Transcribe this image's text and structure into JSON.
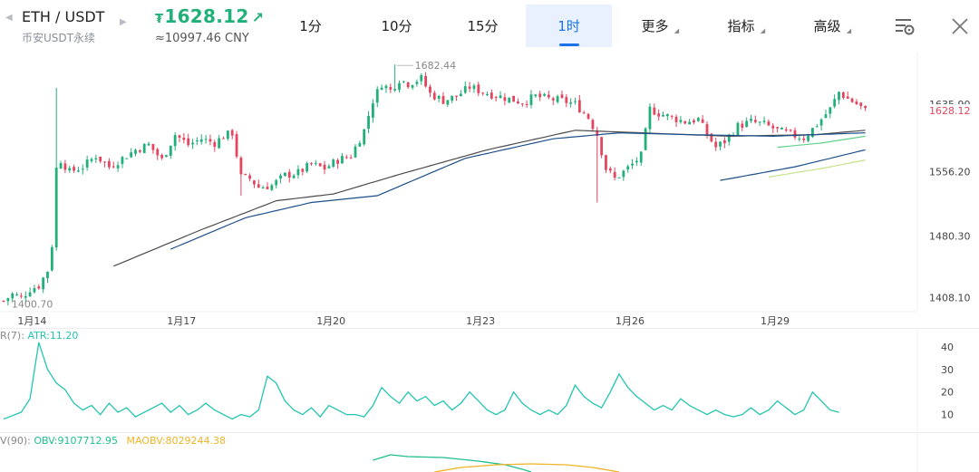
{
  "header": {
    "pair": "ETH / USDT",
    "subtitle": "币安USDT永续",
    "price": "1628.12",
    "currency_symbol": "₮",
    "price_cny": "≈10997.46 CNY",
    "tabs": [
      {
        "label": "1分"
      },
      {
        "label": "10分"
      },
      {
        "label": "15分"
      },
      {
        "label": "1时",
        "active": true
      },
      {
        "label": "更多",
        "dropdown": true
      },
      {
        "label": "指标",
        "dropdown": true
      },
      {
        "label": "高级",
        "dropdown": true
      }
    ],
    "icons": [
      "chart-settings-icon",
      "close-icon"
    ]
  },
  "colors": {
    "up": "#21b07a",
    "down": "#e5455f",
    "active_tab": "#1a73e8",
    "ma_dark": "#4b4b4b",
    "ma_blue": "#1c4f8a",
    "ma_green": "#5fd18d",
    "ma_lime": "#c8e38c",
    "atr": "#22c5b0",
    "obv": "#1fbf8f",
    "maobv": "#f0b429"
  },
  "chart_data": [
    {
      "type": "candlestick",
      "title": "",
      "x_tick_labels": [
        "1月14",
        "1月17",
        "1月20",
        "1月23",
        "1月26",
        "1月29"
      ],
      "y_tick_labels": [
        "1635.90",
        "1556.20",
        "1480.30",
        "1408.10"
      ],
      "y_ticks": [
        1635.9,
        1556.2,
        1480.3,
        1408.1
      ],
      "ylim": [
        1400,
        1688
      ],
      "last_price": 1628.12,
      "last_price_label": "1628.12",
      "high_marker": {
        "value": 1682.44,
        "label": "1682.44"
      },
      "low_marker": {
        "value": 1400.7,
        "label": "1400.70"
      },
      "close_path": [
        [
          0,
          1404
        ],
        [
          2,
          1412
        ],
        [
          4,
          1408
        ],
        [
          6,
          1418
        ],
        [
          8,
          1422
        ],
        [
          10,
          1440
        ],
        [
          11,
          1470
        ],
        [
          12,
          1560
        ],
        [
          13,
          1570
        ],
        [
          15,
          1556
        ],
        [
          18,
          1562
        ],
        [
          21,
          1575
        ],
        [
          24,
          1562
        ],
        [
          27,
          1572
        ],
        [
          30,
          1582
        ],
        [
          33,
          1588
        ],
        [
          36,
          1570
        ],
        [
          39,
          1600
        ],
        [
          42,
          1588
        ],
        [
          45,
          1595
        ],
        [
          48,
          1590
        ],
        [
          50,
          1598
        ],
        [
          52,
          1602
        ],
        [
          54,
          1550
        ],
        [
          56,
          1548
        ],
        [
          58,
          1538
        ],
        [
          61,
          1540
        ],
        [
          64,
          1552
        ],
        [
          67,
          1555
        ],
        [
          70,
          1565
        ],
        [
          73,
          1560
        ],
        [
          76,
          1570
        ],
        [
          79,
          1575
        ],
        [
          82,
          1605
        ],
        [
          84,
          1640
        ],
        [
          86,
          1660
        ],
        [
          88,
          1652
        ],
        [
          90,
          1665
        ],
        [
          92,
          1660
        ],
        [
          95,
          1666
        ],
        [
          97,
          1648
        ],
        [
          100,
          1640
        ],
        [
          103,
          1645
        ],
        [
          106,
          1656
        ],
        [
          109,
          1650
        ],
        [
          112,
          1646
        ],
        [
          115,
          1642
        ],
        [
          118,
          1638
        ],
        [
          121,
          1645
        ],
        [
          124,
          1642
        ],
        [
          127,
          1640
        ],
        [
          130,
          1636
        ],
        [
          133,
          1620
        ],
        [
          135,
          1600
        ],
        [
          137,
          1560
        ],
        [
          139,
          1548
        ],
        [
          141,
          1556
        ],
        [
          143,
          1565
        ],
        [
          145,
          1575
        ],
        [
          147,
          1630
        ],
        [
          149,
          1625
        ],
        [
          152,
          1620
        ],
        [
          155,
          1615
        ],
        [
          158,
          1618
        ],
        [
          160,
          1600
        ],
        [
          162,
          1585
        ],
        [
          164,
          1592
        ],
        [
          167,
          1610
        ],
        [
          170,
          1615
        ],
        [
          173,
          1612
        ],
        [
          176,
          1605
        ],
        [
          179,
          1600
        ],
        [
          182,
          1596
        ],
        [
          185,
          1612
        ],
        [
          188,
          1630
        ],
        [
          190,
          1650
        ],
        [
          192,
          1642
        ],
        [
          194,
          1636
        ],
        [
          196,
          1628
        ]
      ],
      "series": [
        {
          "name": "",
          "color_key": "ma_dark",
          "points": [
            [
              25,
              1445
            ],
            [
              45,
              1488
            ],
            [
              62,
              1522
            ],
            [
              75,
              1530
            ],
            [
              90,
              1553
            ],
            [
              110,
              1582
            ],
            [
              130,
              1605
            ],
            [
              145,
              1602
            ],
            [
              165,
              1598
            ],
            [
              185,
              1600
            ],
            [
              196,
              1605
            ]
          ]
        },
        {
          "name": "",
          "color_key": "ma_blue",
          "points": [
            [
              38,
              1465
            ],
            [
              55,
              1502
            ],
            [
              70,
              1520
            ],
            [
              85,
              1528
            ],
            [
              105,
              1572
            ],
            [
              125,
              1595
            ],
            [
              140,
              1602
            ],
            [
              155,
              1600
            ],
            [
              175,
              1598
            ],
            [
              196,
              1602
            ]
          ]
        },
        {
          "name": "",
          "color_key": "ma_green",
          "points": [
            [
              176,
              1585
            ],
            [
              186,
              1590
            ],
            [
              196,
              1598
            ]
          ]
        },
        {
          "name": "",
          "color_key": "ma_blue",
          "points": [
            [
              163,
              1546
            ],
            [
              180,
              1562
            ],
            [
              196,
              1582
            ]
          ]
        },
        {
          "name": "",
          "color_key": "ma_lime",
          "points": [
            [
              174,
              1550
            ],
            [
              186,
              1560
            ],
            [
              196,
              1570
            ]
          ]
        }
      ]
    },
    {
      "type": "line",
      "label": "R(7):",
      "series": [
        {
          "name": "ATR",
          "value_label": "ATR:11.20",
          "color_key": "atr"
        }
      ],
      "y_tick_labels": [
        "40",
        "30",
        "20",
        "10"
      ],
      "ylim": [
        5,
        42
      ],
      "path": [
        [
          0,
          8
        ],
        [
          4,
          11
        ],
        [
          6,
          17
        ],
        [
          8,
          42
        ],
        [
          10,
          30
        ],
        [
          12,
          24
        ],
        [
          14,
          21
        ],
        [
          16,
          15
        ],
        [
          18,
          12
        ],
        [
          20,
          14
        ],
        [
          22,
          10
        ],
        [
          24,
          15
        ],
        [
          26,
          11
        ],
        [
          28,
          13
        ],
        [
          30,
          9
        ],
        [
          32,
          11
        ],
        [
          34,
          13
        ],
        [
          36,
          15
        ],
        [
          38,
          11
        ],
        [
          40,
          14
        ],
        [
          42,
          10
        ],
        [
          44,
          12
        ],
        [
          46,
          15
        ],
        [
          48,
          12
        ],
        [
          50,
          10
        ],
        [
          52,
          8
        ],
        [
          54,
          10
        ],
        [
          56,
          9
        ],
        [
          58,
          12
        ],
        [
          60,
          27
        ],
        [
          62,
          24
        ],
        [
          64,
          16
        ],
        [
          66,
          12
        ],
        [
          68,
          10
        ],
        [
          70,
          13
        ],
        [
          72,
          9
        ],
        [
          74,
          14
        ],
        [
          76,
          12
        ],
        [
          78,
          10
        ],
        [
          80,
          10
        ],
        [
          82,
          9
        ],
        [
          84,
          14
        ],
        [
          86,
          22
        ],
        [
          88,
          18
        ],
        [
          90,
          15
        ],
        [
          92,
          20
        ],
        [
          94,
          16
        ],
        [
          96,
          18
        ],
        [
          98,
          14
        ],
        [
          100,
          16
        ],
        [
          102,
          12
        ],
        [
          104,
          15
        ],
        [
          106,
          20
        ],
        [
          108,
          16
        ],
        [
          110,
          12
        ],
        [
          112,
          10
        ],
        [
          114,
          12
        ],
        [
          116,
          20
        ],
        [
          118,
          15
        ],
        [
          120,
          12
        ],
        [
          122,
          10
        ],
        [
          124,
          12
        ],
        [
          126,
          10
        ],
        [
          128,
          14
        ],
        [
          130,
          23
        ],
        [
          132,
          18
        ],
        [
          134,
          15
        ],
        [
          136,
          13
        ],
        [
          138,
          20
        ],
        [
          140,
          28
        ],
        [
          142,
          22
        ],
        [
          144,
          18
        ],
        [
          146,
          15
        ],
        [
          148,
          12
        ],
        [
          150,
          14
        ],
        [
          152,
          12
        ],
        [
          154,
          17
        ],
        [
          156,
          14
        ],
        [
          158,
          12
        ],
        [
          160,
          10
        ],
        [
          162,
          12
        ],
        [
          164,
          10
        ],
        [
          166,
          9
        ],
        [
          168,
          10
        ],
        [
          170,
          13
        ],
        [
          172,
          10
        ],
        [
          174,
          12
        ],
        [
          176,
          16
        ],
        [
          178,
          13
        ],
        [
          180,
          10
        ],
        [
          182,
          12
        ],
        [
          184,
          20
        ],
        [
          186,
          16
        ],
        [
          188,
          12
        ],
        [
          190,
          11
        ]
      ]
    },
    {
      "type": "line",
      "label": "V(90):",
      "series": [
        {
          "name": "OBV",
          "value_label": "OBV:9107712.95",
          "color_key": "obv"
        },
        {
          "name": "MAOBV",
          "value_label": "MAOBV:8029244.38",
          "color_key": "maobv"
        }
      ]
    }
  ]
}
